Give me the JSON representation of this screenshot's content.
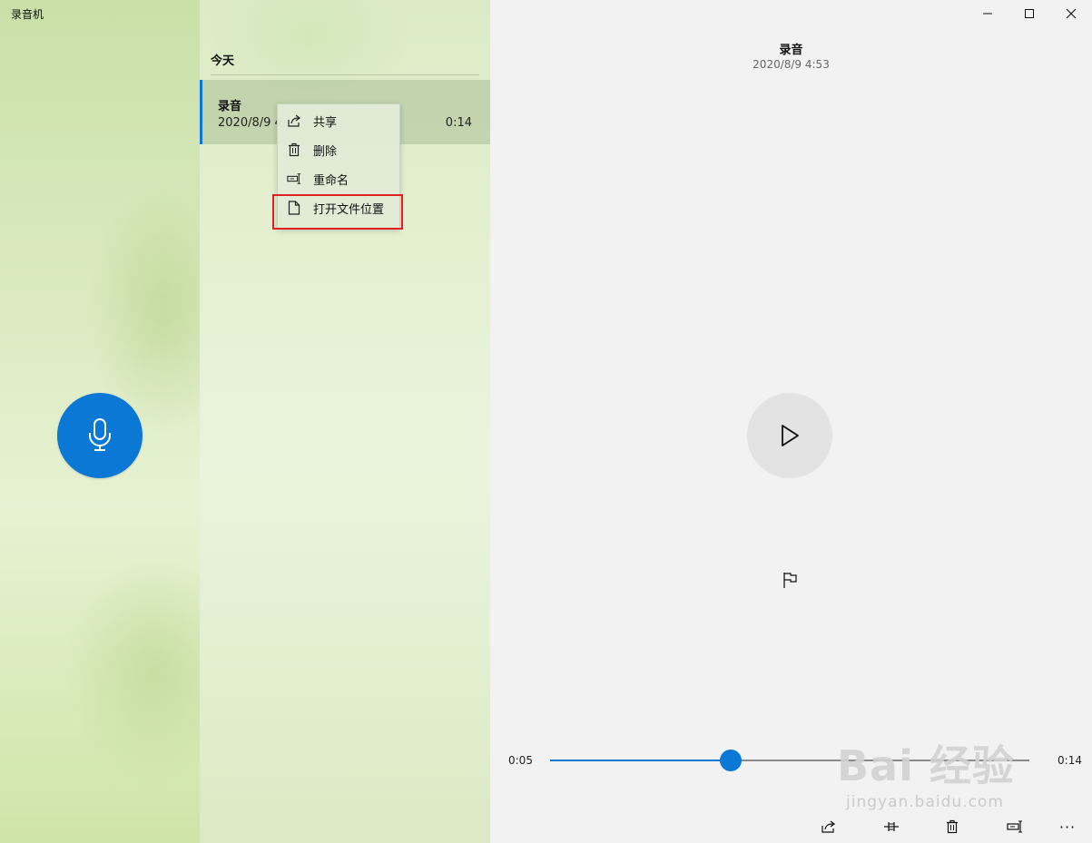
{
  "app": {
    "title": "录音机"
  },
  "colors": {
    "accent": "#0a78d4",
    "highlight_border": "#e02020"
  },
  "list": {
    "group_header": "今天",
    "items": [
      {
        "name": "录音",
        "date": "2020/8/9 4",
        "duration": "0:14"
      }
    ]
  },
  "context_menu": {
    "items": [
      {
        "label": "共享",
        "icon": "share-icon"
      },
      {
        "label": "删除",
        "icon": "trash-icon"
      },
      {
        "label": "重命名",
        "icon": "rename-icon"
      },
      {
        "label": "打开文件位置",
        "icon": "file-icon"
      }
    ]
  },
  "player": {
    "title": "录音",
    "date": "2020/8/9 4:53",
    "current_time": "0:05",
    "total_time": "0:14",
    "progress_fraction": 0.376
  },
  "toolbar": {
    "items": [
      "share-icon",
      "trim-icon",
      "trash-icon",
      "rename-icon",
      "more-icon"
    ],
    "more_label": "···"
  },
  "watermark": {
    "brand": "Bai 经验",
    "sub": "jingyan.baidu.com"
  }
}
